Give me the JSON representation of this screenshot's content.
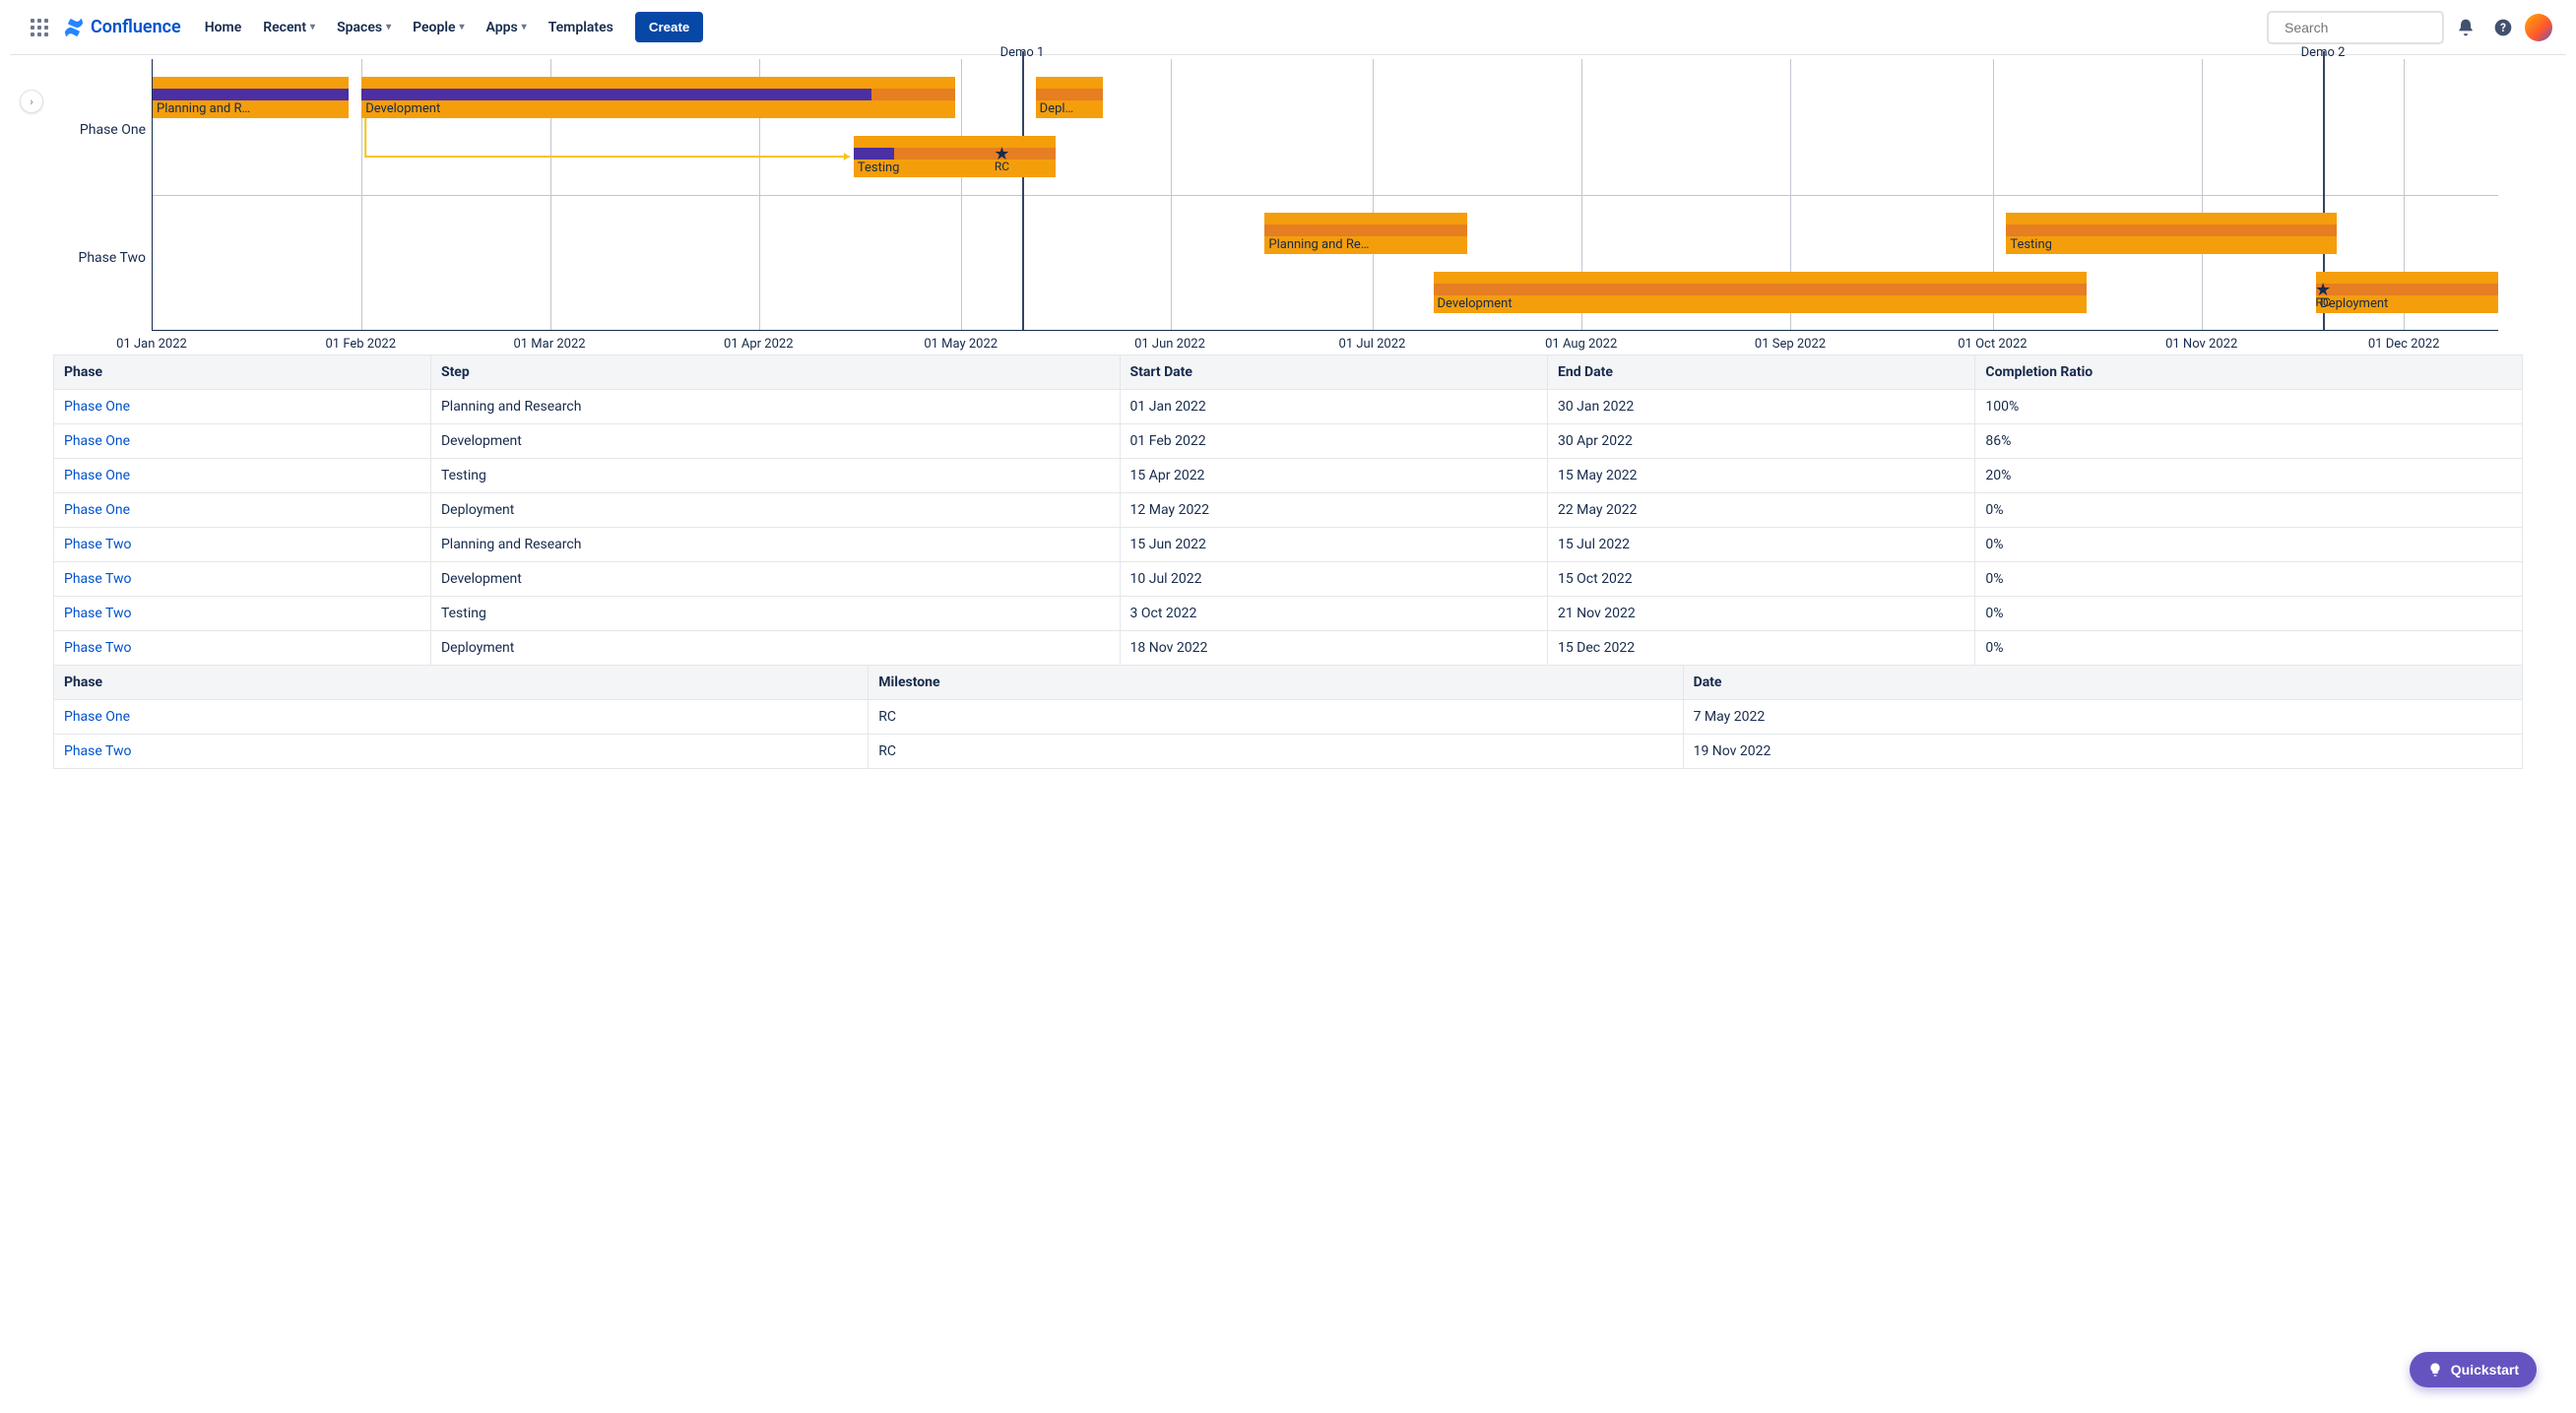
{
  "brand": {
    "name": "Confluence"
  },
  "nav": {
    "home": "Home",
    "recent": "Recent",
    "spaces": "Spaces",
    "people": "People",
    "apps": "Apps",
    "templates": "Templates",
    "create": "Create"
  },
  "search": {
    "placeholder": "Search"
  },
  "quickstart": "Quickstart",
  "chart_data": {
    "type": "gantt",
    "x_ticks": [
      "01 Jan 2022",
      "01 Feb 2022",
      "01 Mar 2022",
      "01 Apr 2022",
      "01 May 2022",
      "01 Jun 2022",
      "01 Jul 2022",
      "01 Aug 2022",
      "01 Sep 2022",
      "01 Oct 2022",
      "01 Nov 2022",
      "01 Dec 2022"
    ],
    "y_groups": [
      "Phase One",
      "Phase Two"
    ],
    "markers": [
      {
        "label": "Demo 1",
        "date": "10 May 2022"
      },
      {
        "label": "Demo 2",
        "date": "19 Nov 2022"
      }
    ],
    "bars": [
      {
        "group": "Phase One",
        "row": 0,
        "label": "Planning and R…",
        "start": "01 Jan 2022",
        "end": "30 Jan 2022",
        "completion": 1.0
      },
      {
        "group": "Phase One",
        "row": 0,
        "label": "Development",
        "start": "01 Feb 2022",
        "end": "30 Apr 2022",
        "completion": 0.86
      },
      {
        "group": "Phase One",
        "row": 1,
        "label": "Testing",
        "start": "15 Apr 2022",
        "end": "15 May 2022",
        "completion": 0.2
      },
      {
        "group": "Phase One",
        "row": 0,
        "label": "Depl…",
        "start": "12 May 2022",
        "end": "22 May 2022",
        "completion": 0.0
      },
      {
        "group": "Phase Two",
        "row": 0,
        "label": "Planning and Re…",
        "start": "15 Jun 2022",
        "end": "15 Jul 2022",
        "completion": 0.0
      },
      {
        "group": "Phase Two",
        "row": 1,
        "label": "Development",
        "start": "10 Jul 2022",
        "end": "15 Oct 2022",
        "completion": 0.0
      },
      {
        "group": "Phase Two",
        "row": 0,
        "label": "Testing",
        "start": "03 Oct 2022",
        "end": "21 Nov 2022",
        "completion": 0.0
      },
      {
        "group": "Phase Two",
        "row": 1,
        "label": "Deployment",
        "start": "18 Nov 2022",
        "end": "15 Dec 2022",
        "completion": 0.0
      }
    ],
    "milestones": [
      {
        "group": "Phase One",
        "row": 1,
        "label": "RC",
        "date": "07 May 2022"
      },
      {
        "group": "Phase Two",
        "row": 1,
        "label": "RC",
        "date": "19 Nov 2022"
      }
    ]
  },
  "table1": {
    "headers": [
      "Phase",
      "Step",
      "Start Date",
      "End Date",
      "Completion Ratio"
    ],
    "rows": [
      [
        "Phase One",
        "Planning and Research",
        "01 Jan 2022",
        "30 Jan 2022",
        "100%"
      ],
      [
        "Phase One",
        "Development",
        "01 Feb 2022",
        "30 Apr 2022",
        "86%"
      ],
      [
        "Phase One",
        "Testing",
        "15 Apr 2022",
        "15 May 2022",
        "20%"
      ],
      [
        "Phase One",
        "Deployment",
        "12 May 2022",
        "22 May 2022",
        "0%"
      ],
      [
        "Phase Two",
        "Planning and Research",
        "15 Jun 2022",
        "15 Jul 2022",
        "0%"
      ],
      [
        "Phase Two",
        "Development",
        "10 Jul 2022",
        "15 Oct 2022",
        "0%"
      ],
      [
        "Phase Two",
        "Testing",
        "3 Oct 2022",
        "21 Nov 2022",
        "0%"
      ],
      [
        "Phase Two",
        "Deployment",
        "18 Nov 2022",
        "15 Dec 2022",
        "0%"
      ]
    ]
  },
  "table2": {
    "headers": [
      "Phase",
      "Milestone",
      "Date"
    ],
    "rows": [
      [
        "Phase One",
        "RC",
        "7 May 2022"
      ],
      [
        "Phase Two",
        "RC",
        "19 Nov 2022"
      ]
    ]
  }
}
